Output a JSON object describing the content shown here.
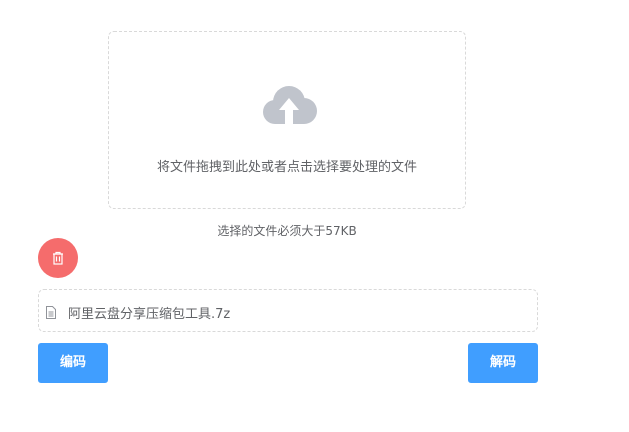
{
  "upload": {
    "icon": "cloud-upload-icon",
    "text": "将文件拖拽到此处或者点击选择要处理的文件",
    "tip": "选择的文件必须大于57KB"
  },
  "delete_button": {
    "icon": "trash-icon"
  },
  "file": {
    "icon": "document-icon",
    "name": "阿里云盘分享压缩包工具.7z"
  },
  "actions": {
    "encode_label": "编码",
    "decode_label": "解码"
  },
  "colors": {
    "primary": "#409eff",
    "danger": "#f56c6c",
    "icon_gray": "#c0c4cc",
    "text": "#606266",
    "border": "#d9d9d9"
  }
}
